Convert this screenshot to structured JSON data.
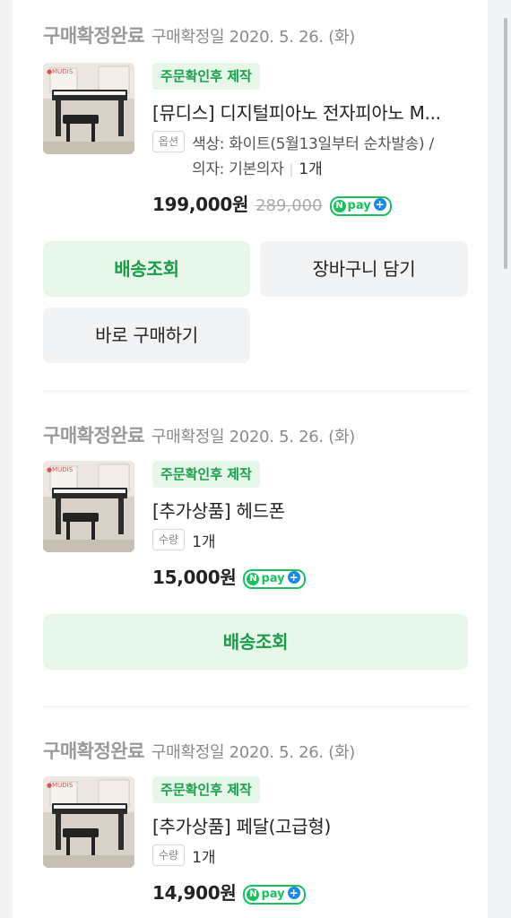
{
  "orders": [
    {
      "status": "구매확정완료",
      "date": "구매확정일 2020. 5. 26. (화)",
      "tag": "주문확인후 제작",
      "name": "[뮤디스] 디지털피아노 전자피아노 M...",
      "option_chip": "옵션",
      "option_line1": "색상: 화이트(5월13일부터 순차발송) /",
      "option_line2": "의자: 기본의자",
      "option_qty": "1개",
      "price": "199,000원",
      "original_price": "289,000",
      "pay_badge": "pay",
      "buttons": {
        "track": "배송조회",
        "cart": "장바구니 담기",
        "buy_now": "바로 구매하기"
      }
    },
    {
      "status": "구매확정완료",
      "date": "구매확정일 2020. 5. 26. (화)",
      "tag": "주문확인후 제작",
      "name": "[추가상품] 헤드폰",
      "qty_chip": "수량",
      "qty": "1개",
      "price": "15,000원",
      "pay_badge": "pay",
      "buttons": {
        "track": "배송조회"
      }
    },
    {
      "status": "구매확정완료",
      "date": "구매확정일 2020. 5. 26. (화)",
      "tag": "주문확인후 제작",
      "name": "[추가상품] 페달(고급형)",
      "qty_chip": "수량",
      "qty": "1개",
      "price": "14,900원",
      "pay_badge": "pay"
    }
  ],
  "colors": {
    "accent_green": "#1a9c46",
    "tag_bg": "#e7f8ea",
    "npay_green": "#19c15e",
    "npay_plus_blue": "#1e88e5"
  },
  "icons": [
    "naver-pay-logo",
    "product-thumbnail"
  ]
}
